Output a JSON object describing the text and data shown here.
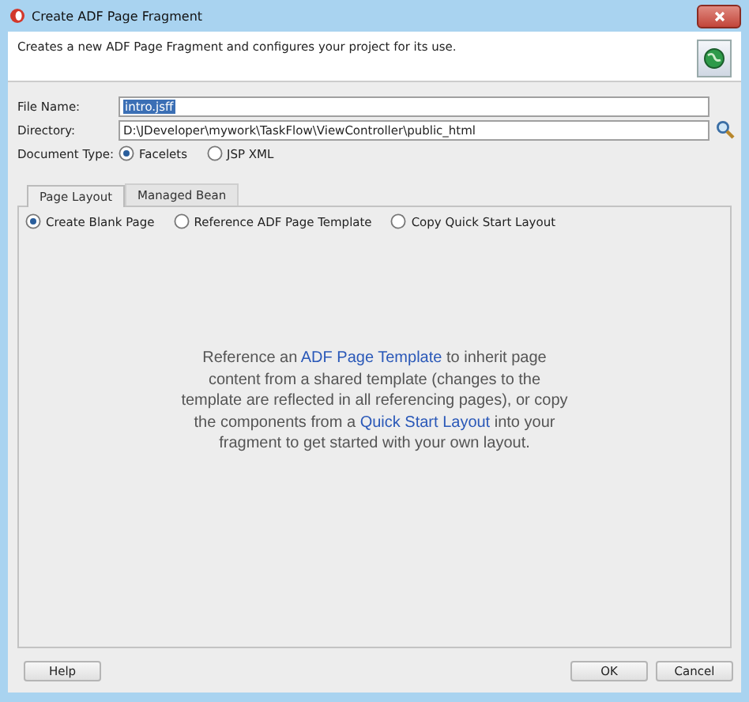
{
  "window": {
    "title": "Create ADF Page Fragment"
  },
  "header": {
    "text": "Creates a new ADF Page Fragment and configures your project for its use."
  },
  "fields": [
    {
      "label": "File Name:",
      "value": "intro.jsff",
      "selected_text": true,
      "browse": false
    },
    {
      "label": "Directory:",
      "value": "D:\\JDeveloper\\mywork\\TaskFlow\\ViewController\\public_html",
      "selected_text": false,
      "browse": true
    }
  ],
  "document_type": {
    "label": "Document Type:",
    "options": [
      {
        "label": "Facelets",
        "selected": true
      },
      {
        "label": "JSP XML",
        "selected": false
      }
    ]
  },
  "tabs": [
    {
      "label": "Page Layout",
      "selected": true
    },
    {
      "label": "Managed Bean",
      "selected": false
    }
  ],
  "layout_options": [
    {
      "label": "Create Blank Page",
      "selected": true
    },
    {
      "label": "Reference ADF Page Template",
      "selected": false
    },
    {
      "label": "Copy Quick Start Layout",
      "selected": false
    }
  ],
  "description": [
    {
      "kind": "text",
      "text": "Reference an "
    },
    {
      "kind": "link",
      "text": "ADF Page Template"
    },
    {
      "kind": "text",
      "text": " to inherit page content from a shared template (changes to the template are reflected in all referencing pages), or copy the components from a "
    },
    {
      "kind": "link",
      "text": "Quick Start Layout"
    },
    {
      "kind": "text",
      "text": " into your fragment to get started with your own layout."
    }
  ],
  "buttons": {
    "left": [
      "Help"
    ],
    "right": [
      "OK",
      "Cancel"
    ]
  }
}
